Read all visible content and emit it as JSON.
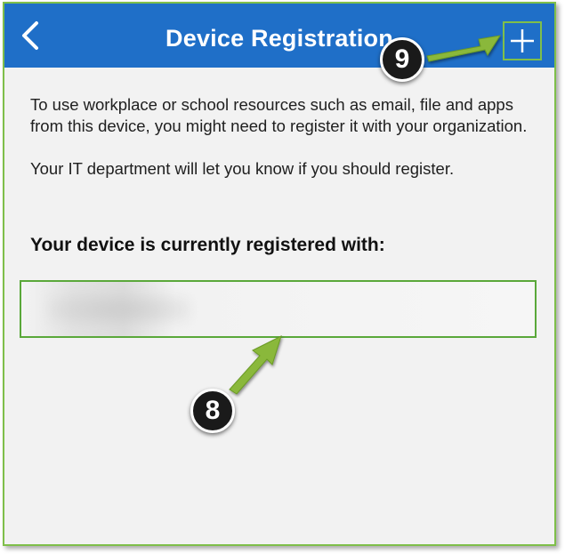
{
  "header": {
    "back_icon": "chevron-left-icon",
    "title": "Device Registration",
    "add_icon": "plus-icon",
    "bar_color": "#1f6fc8"
  },
  "main": {
    "paragraph_1": "To use workplace or school resources such as email, file and apps from this device, you might need to register it with your organization.",
    "paragraph_2": "Your IT department will let you know if you should register.",
    "registered_heading": "Your device is currently registered with:",
    "registered_value": ""
  },
  "annotations": {
    "callout_8": "8",
    "callout_9": "9",
    "arrow_color": "#8ab83a",
    "highlight_color": "#7fbf4a"
  }
}
